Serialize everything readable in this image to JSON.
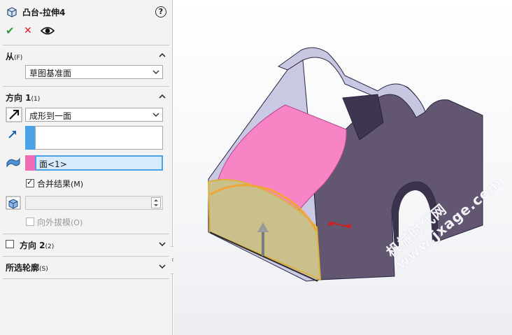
{
  "header": {
    "title": "凸台-拉伸4",
    "help_label": "?"
  },
  "actions": {
    "ok_label": "✔",
    "cancel_label": "✕"
  },
  "from": {
    "heading": "从",
    "heading_key": "(F)",
    "start_condition": "草图基准面"
  },
  "direction1": {
    "heading": "方向 1",
    "heading_key": "(1)",
    "end_condition": "成形到一面",
    "face_selection": "面<1>",
    "merge_result_label": "合并结果",
    "merge_result_key": "(M)",
    "merge_result_checked": true,
    "draft_outward_label": "向外拔模",
    "draft_outward_key": "(O)",
    "draft_outward_checked": false
  },
  "direction2": {
    "heading": "方向 2",
    "heading_key": "(2)",
    "checked": false
  },
  "selected_contours": {
    "heading": "所选轮廓",
    "heading_key": "(S)"
  },
  "viewport": {
    "watermark_line1": "机械时代网",
    "watermark_line2": "www.jxage.com"
  },
  "colors": {
    "accent_blue": "#4aa3e8",
    "swatch_pink": "#f06ab4",
    "part_purple": "#625671",
    "part_light": "#c4c4e0",
    "extrude_pink": "#f784c4",
    "sketch_face": "#c9c08c",
    "highlight_orange": "#f0a53a"
  }
}
